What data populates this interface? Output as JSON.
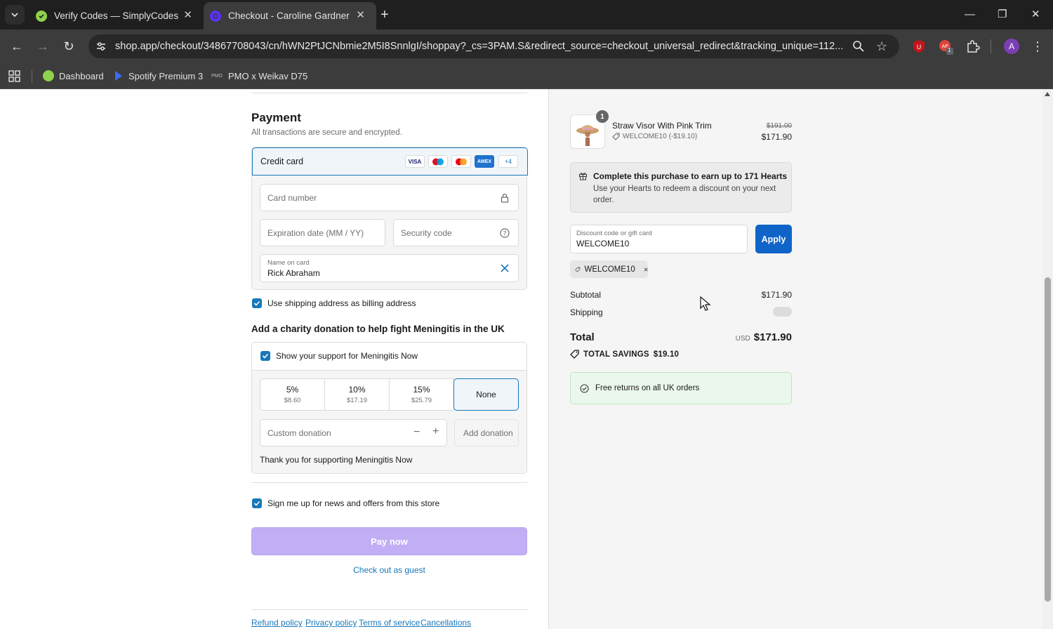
{
  "browser": {
    "tabs": [
      {
        "title": "Verify Codes — SimplyCodes",
        "active": false
      },
      {
        "title": "Checkout - Caroline Gardner",
        "active": true
      }
    ],
    "url": "shop.app/checkout/34867708043/cn/hWN2PtJCNbmie2M5I8SnnlgI/shoppay?_cs=3PAM.S&redirect_source=checkout_universal_redirect&tracking_unique=112...",
    "extension_badge": "1",
    "profile_initial": "A",
    "bookmarks": [
      {
        "label": "Dashboard"
      },
      {
        "label": "Spotify Premium 3"
      },
      {
        "label": "PMO x Weikav D75"
      }
    ]
  },
  "payment": {
    "heading": "Payment",
    "subheading": "All transactions are secure and encrypted.",
    "method_label": "Credit card",
    "card_logos": [
      "VISA",
      "Maestro",
      "Mastercard",
      "AMEX"
    ],
    "more_cards": "+4",
    "card_number_placeholder": "Card number",
    "expiry_placeholder": "Expiration date (MM / YY)",
    "security_placeholder": "Security code",
    "name_label": "Name on card",
    "name_value": "Rick Abraham",
    "billing_checkbox_label": "Use shipping address as billing address"
  },
  "charity": {
    "heading": "Add a charity donation to help fight Meningitis in the UK",
    "support_label": "Show your support for Meningitis Now",
    "options": [
      {
        "pct": "5%",
        "amount": "$8.60"
      },
      {
        "pct": "10%",
        "amount": "$17.19"
      },
      {
        "pct": "15%",
        "amount": "$25.79"
      },
      {
        "pct": "None",
        "amount": ""
      }
    ],
    "selected": "None",
    "custom_placeholder": "Custom donation",
    "add_button": "Add donation",
    "thanks": "Thank you for supporting Meningitis Now"
  },
  "newsletter_label": "Sign me up for news and offers from this store",
  "pay_button": "Pay now",
  "guest_link": "Check out as guest",
  "footer_links": [
    "Refund policy",
    "Privacy policy",
    "Terms of service",
    "Cancellations"
  ],
  "summary": {
    "item": {
      "quantity": "1",
      "name": "Straw Visor With Pink Trim",
      "discount": "WELCOME10 (-$19.10)",
      "original_price": "$191.00",
      "price": "$171.90"
    },
    "hearts_title": "Complete this purchase to earn up to 171 Hearts",
    "hearts_text": "Use your Hearts to redeem a discount on your next order.",
    "discount_label": "Discount code or gift card",
    "discount_value": "WELCOME10",
    "apply_button": "Apply",
    "applied_code": "WELCOME10",
    "subtotal_label": "Subtotal",
    "subtotal_value": "$171.90",
    "shipping_label": "Shipping",
    "total_label": "Total",
    "currency": "USD",
    "total_value": "$171.90",
    "savings_label": "TOTAL SAVINGS",
    "savings_value": "$19.10",
    "returns_text": "Free returns on all UK orders"
  },
  "colors": {
    "accent_blue": "#1878b9",
    "apply_blue": "#1064c8",
    "pay_button": "#c1aef5",
    "returns_green_bg": "#eaf7ec"
  }
}
